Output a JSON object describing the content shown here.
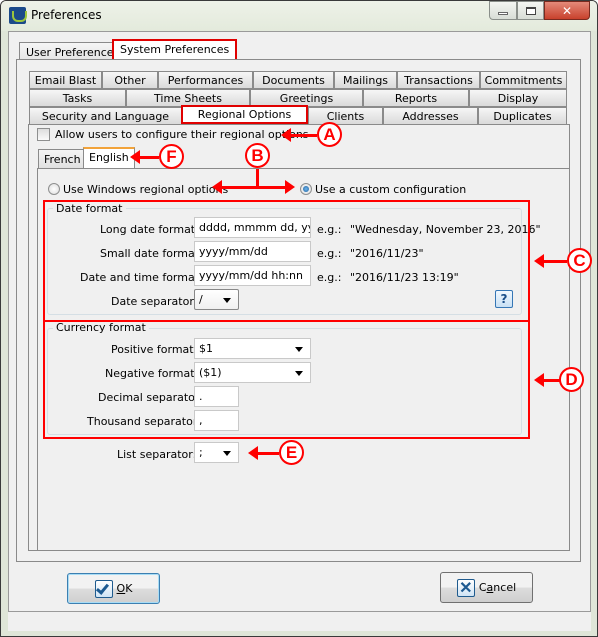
{
  "window": {
    "title": "Preferences",
    "controls": {
      "minimize": "minimize",
      "maximize": "maximize",
      "close": "close"
    }
  },
  "top_tabs": [
    {
      "label": "User Preferences",
      "active": false
    },
    {
      "label": "System Preferences",
      "active": true
    }
  ],
  "sub_tabs": {
    "row1": [
      "Email Blast",
      "Other",
      "Performances",
      "Documents",
      "Mailings",
      "Transactions",
      "Commitments"
    ],
    "row2": [
      "Tasks",
      "Time Sheets",
      "Greetings",
      "Reports",
      "Display"
    ],
    "row3": [
      "Security and Language",
      "Regional Options",
      "Clients",
      "Addresses",
      "Duplicates"
    ],
    "active": "Regional Options"
  },
  "allow_users": {
    "label": "Allow users to configure their regional options",
    "checked": false
  },
  "language_tabs": [
    {
      "label": "French",
      "active": false
    },
    {
      "label": "English",
      "active": true
    }
  ],
  "source_options": {
    "windows_label": "Use Windows regional options",
    "custom_label": "Use a custom configuration",
    "selected": "custom"
  },
  "date_format": {
    "title": "Date format",
    "long": {
      "label": "Long date format:",
      "value": "dddd, mmmm dd, yyyy",
      "example_prefix": "e.g.:",
      "example": "\"Wednesday, November 23, 2016\""
    },
    "small": {
      "label": "Small date format:",
      "value": "yyyy/mm/dd",
      "example_prefix": "e.g.:",
      "example": "\"2016/11/23\""
    },
    "datetime": {
      "label": "Date and time format:",
      "value": "yyyy/mm/dd hh:nn",
      "example_prefix": "e.g.:",
      "example": "\"2016/11/23 13:19\""
    },
    "separator": {
      "label": "Date separator:",
      "value": "/"
    },
    "help": "?"
  },
  "currency_format": {
    "title": "Currency format",
    "positive": {
      "label": "Positive format:",
      "value": "$1"
    },
    "negative": {
      "label": "Negative format:",
      "value": "($1)"
    },
    "decimal": {
      "label": "Decimal separator:",
      "value": "."
    },
    "thousand": {
      "label": "Thousand separator:",
      "value": ","
    }
  },
  "list_separator": {
    "label": "List separator:",
    "value": ";"
  },
  "callouts": [
    "A",
    "B",
    "C",
    "D",
    "E",
    "F"
  ],
  "buttons": {
    "ok": "OK",
    "ok_mnemonic": "O",
    "ok_rest": "K",
    "cancel_pre": "C",
    "cancel_mnemonic": "a",
    "cancel_rest": "ncel"
  },
  "colors": {
    "annotation_red": "#ff0000",
    "active_tab_accent": "#f2a33a"
  }
}
